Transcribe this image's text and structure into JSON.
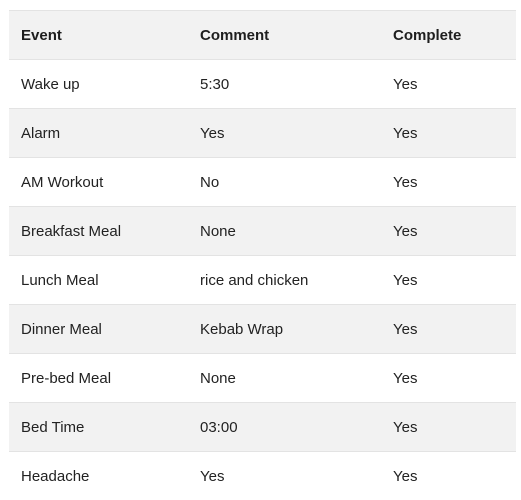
{
  "table": {
    "headers": [
      "Event",
      "Comment",
      "Complete"
    ],
    "rows": [
      [
        "Wake up",
        "5:30",
        "Yes"
      ],
      [
        "Alarm",
        "Yes",
        "Yes"
      ],
      [
        "AM Workout",
        "No",
        "Yes"
      ],
      [
        "Breakfast Meal",
        "None",
        "Yes"
      ],
      [
        "Lunch Meal",
        "rice and chicken",
        "Yes"
      ],
      [
        "Dinner Meal",
        "Kebab Wrap",
        "Yes"
      ],
      [
        "Pre-bed Meal",
        "None",
        "Yes"
      ],
      [
        "Bed Time",
        "03:00",
        "Yes"
      ],
      [
        "Headache",
        "Yes",
        "Yes"
      ]
    ]
  }
}
